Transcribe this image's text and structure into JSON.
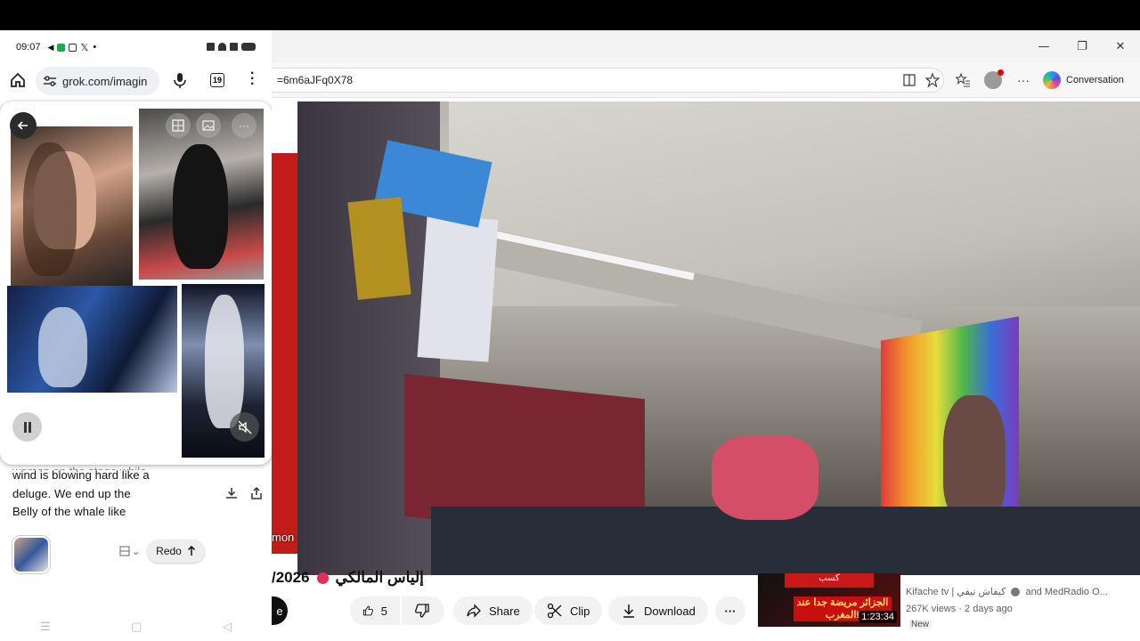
{
  "phone": {
    "status": {
      "time": "09:07",
      "x_icon": "𝕏"
    },
    "browser": {
      "url": "grok.com/imagin",
      "tab_count": "19"
    },
    "prompt_lines": [
      "wind is blowing hard like a",
      "deluge. We end up the",
      "Belly of the whale like"
    ],
    "prompt_cut_line": "woman on the stage while",
    "redo_label": "Redo"
  },
  "desktop": {
    "address": "=6m6aJFq0X78",
    "conversation_label": "Conversation",
    "thumb_text": "mon a",
    "video_title": "/2026",
    "video_title_arabic": "إلياس المالكي",
    "actions": {
      "subscribe_partial": "e",
      "like_count": "5",
      "share": "Share",
      "clip": "Clip",
      "download": "Download"
    },
    "suggestion": {
      "thumb_top": "كسب",
      "thumb_main": "الجزائر مريضة جدا عند المغرب!",
      "duration": "1:23:34",
      "channel": "Kifache tv | كيفاش تيفي",
      "channel_more": "and MedRadio O...",
      "views": "267K views",
      "age": "2 days ago",
      "badge": "New"
    }
  },
  "colors": {
    "accent_red": "#c31a1a",
    "copilot": "#6f4bd8"
  }
}
